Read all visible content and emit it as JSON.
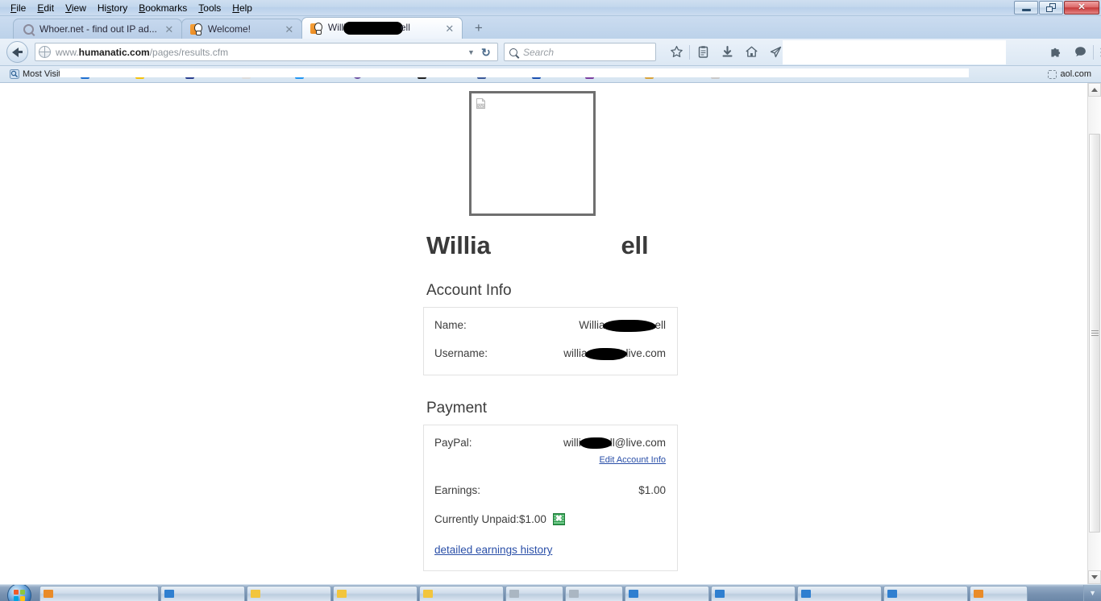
{
  "browser": {
    "menus": [
      {
        "label": "File",
        "accel": "F"
      },
      {
        "label": "Edit",
        "accel": "E"
      },
      {
        "label": "View",
        "accel": "V"
      },
      {
        "label": "History",
        "accel": "s"
      },
      {
        "label": "Bookmarks",
        "accel": "B"
      },
      {
        "label": "Tools",
        "accel": "T"
      },
      {
        "label": "Help",
        "accel": "H"
      }
    ],
    "window_controls": {
      "minimize": "minimize",
      "restore": "restore",
      "close": "✕"
    },
    "tabs": [
      {
        "title": "Whoer.net - find out IP ad...",
        "favicon": "search-icon",
        "active": false,
        "close": "✕"
      },
      {
        "title": "Welcome!",
        "favicon": "humanatic-icon",
        "active": false,
        "close": "✕"
      },
      {
        "title_prefix": "Willi",
        "title_suffix": "ell",
        "redacted": true,
        "favicon": "humanatic-icon",
        "active": true,
        "close": "✕"
      }
    ],
    "new_tab_label": "+",
    "url": {
      "prefix": "www.",
      "host": "humanatic.com",
      "path": "/pages/results.cfm",
      "dropdown": "▼",
      "reload": "↻"
    },
    "search": {
      "placeholder": "Search"
    },
    "toolbar_icons": [
      {
        "name": "bookmark-star-icon"
      },
      {
        "name": "reading-list-icon"
      },
      {
        "name": "downloads-icon"
      },
      {
        "name": "home-icon"
      },
      {
        "name": "send-page-icon"
      },
      {
        "name": "addon-puzzle-icon"
      },
      {
        "name": "chat-bubble-icon"
      },
      {
        "name": "hamburger-menu-icon"
      }
    ],
    "bookmarks": {
      "most_visited": "Most Visited",
      "last_item": "aol.com",
      "obscured_count": 11
    }
  },
  "page": {
    "avatar_alt": "broken-image",
    "profile_name_prefix": "Willi",
    "profile_name_middle_redacted": "a",
    "profile_name_suffix": "ell",
    "account_section": {
      "title": "Account Info",
      "rows": [
        {
          "label": "Name:",
          "value_prefix": "Willia",
          "value_suffix": "ell",
          "redacted": true
        },
        {
          "label": "Username:",
          "value_prefix": "willia",
          "value_suffix": "live.com",
          "redacted": true
        }
      ]
    },
    "payment_section": {
      "title": "Payment",
      "paypal_label": "PayPal:",
      "paypal_value_prefix": "willi",
      "paypal_value_suffix": "ll@live.com",
      "edit_link": "Edit Account Info",
      "earnings_label": "Earnings:",
      "earnings_value": "$1.00",
      "unpaid_label": "Currently Unpaid:",
      "unpaid_value": "$1.00",
      "export_icon": "excel-export-icon",
      "history_link": "detailed earnings history"
    }
  },
  "scrollbar": {
    "up": "▲",
    "down": "▼"
  },
  "taskbar": {
    "start": "start-orb",
    "items": 11
  },
  "colors": {
    "link": "#2a4fa8",
    "chrome_blue": "#c3d7ed",
    "close_red": "#c63b3b",
    "excel_green": "#2f9e4f",
    "text": "#3c3c3c"
  }
}
